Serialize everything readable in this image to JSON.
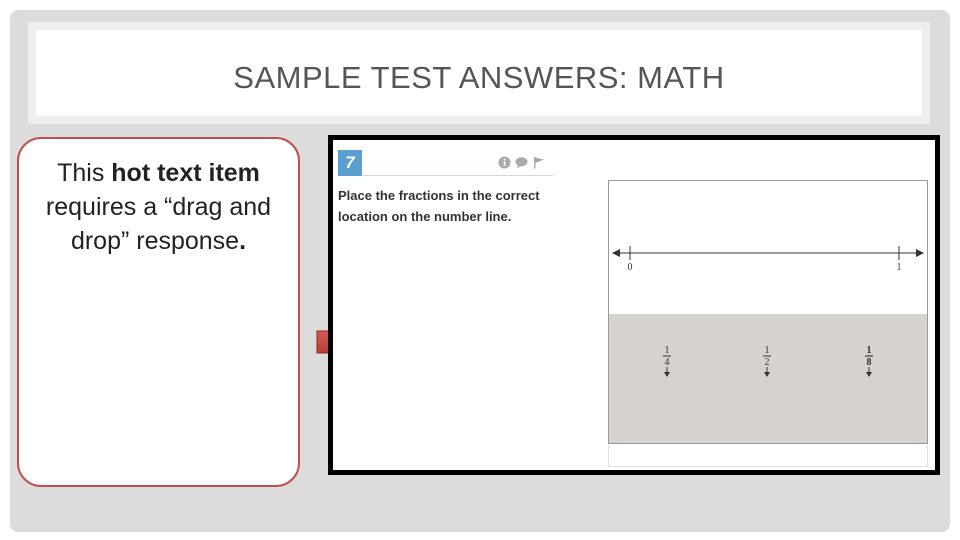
{
  "slide": {
    "title": "SAMPLE TEST ANSWERS: MATH",
    "note": {
      "part1": "This ",
      "bold1": "hot text item",
      "part2": " requires a “drag and drop” response",
      "bold2": "."
    }
  },
  "question": {
    "number": "7",
    "prompt": "Place the fractions in the correct location on the number line.",
    "icons": [
      "info-icon",
      "comment-icon",
      "flag-icon"
    ]
  },
  "number_line": {
    "start_label": "0",
    "end_label": "1"
  },
  "fractions": [
    {
      "numerator": "1",
      "denominator": "4"
    },
    {
      "numerator": "1",
      "denominator": "2"
    },
    {
      "numerator": "1",
      "denominator": "8"
    }
  ],
  "colors": {
    "accent_red": "#c0504d",
    "question_blue": "#5b9fcf",
    "tray_gray": "#d6d3cf"
  }
}
